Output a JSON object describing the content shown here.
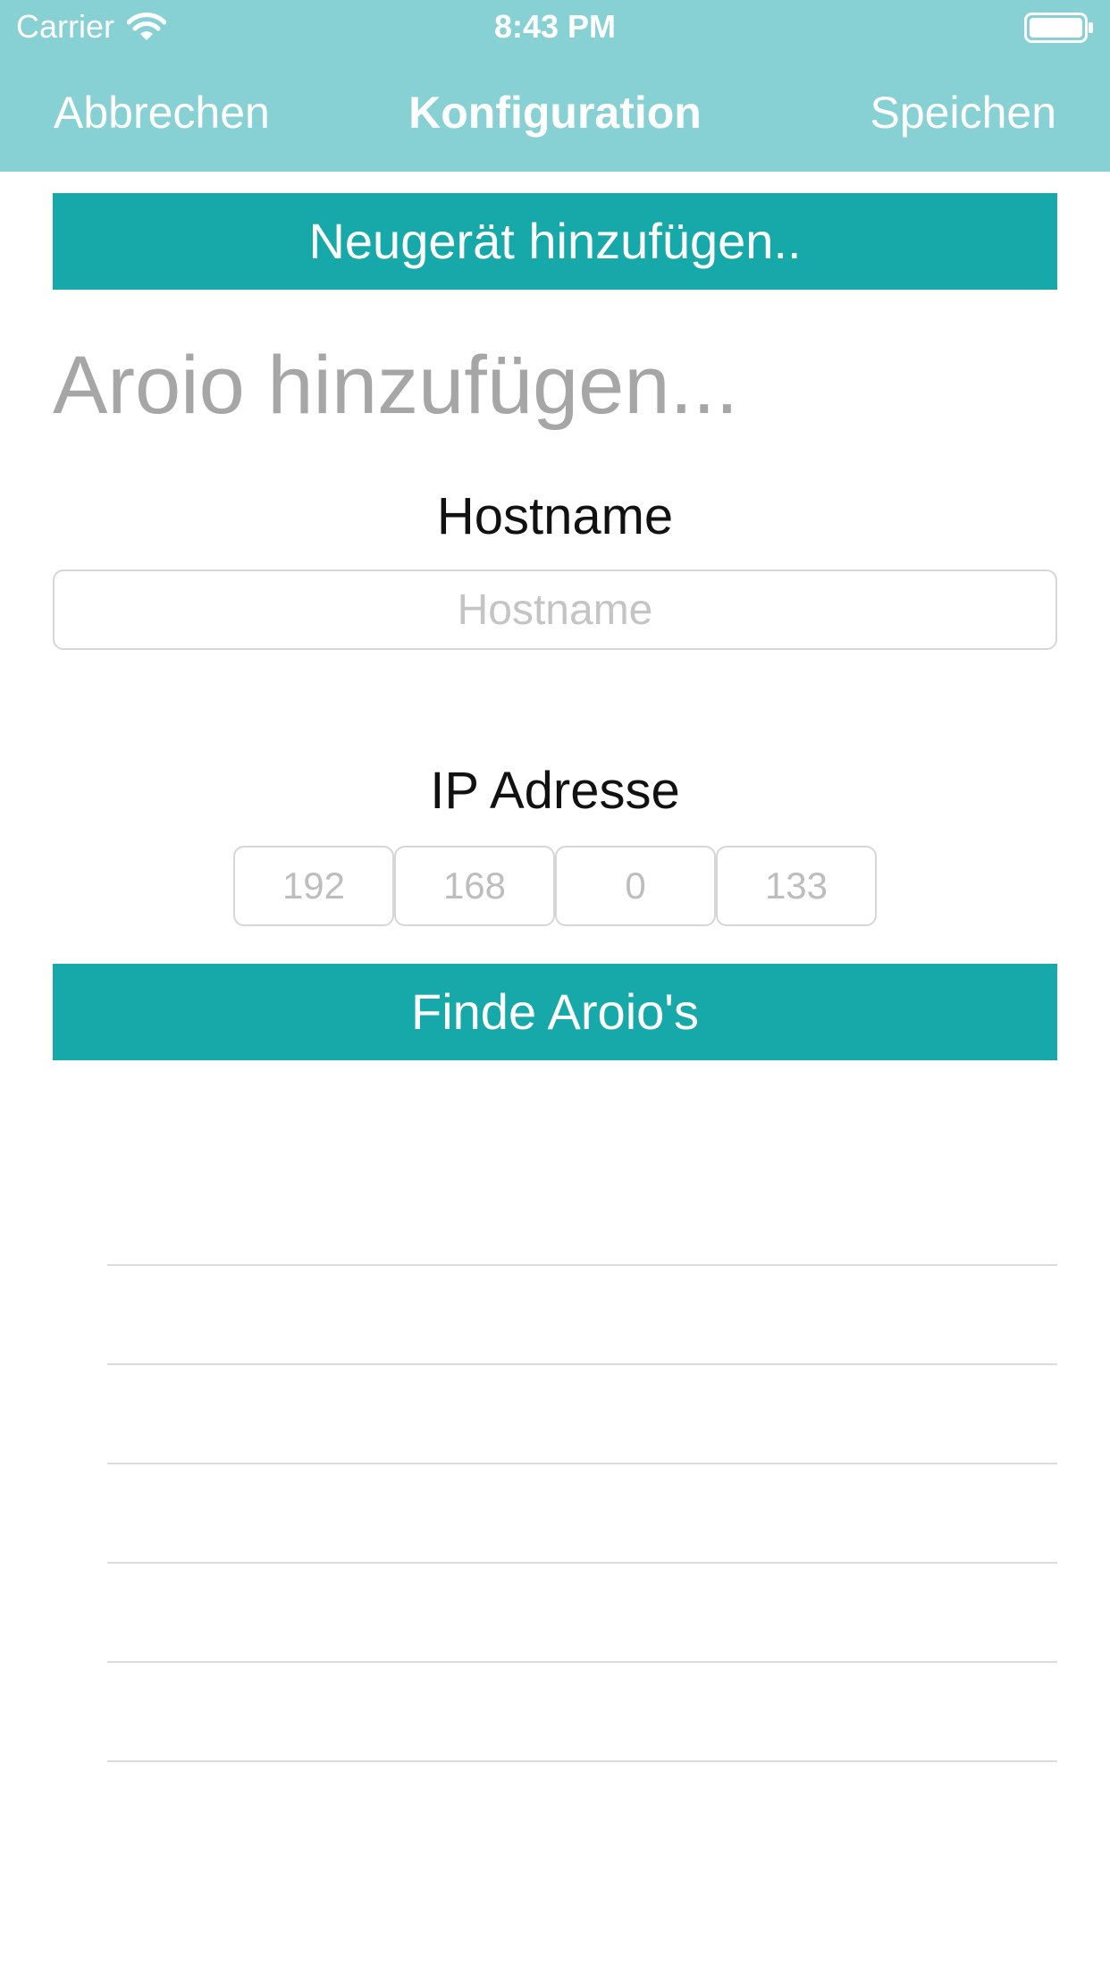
{
  "status_bar": {
    "carrier": "Carrier",
    "time": "8:43 PM",
    "wifi_icon": "wifi-icon",
    "battery_icon": "battery-icon"
  },
  "nav_bar": {
    "cancel_label": "Abbrechen",
    "title": "Konfiguration",
    "save_label": "Speichen"
  },
  "add_new_device_button": "Neugerät hinzufügen..",
  "section_heading": "Aroio hinzufügen...",
  "hostname": {
    "label": "Hostname",
    "placeholder": "Hostname",
    "value": ""
  },
  "ip_address": {
    "label": "IP Adresse",
    "octets": [
      {
        "placeholder": "192",
        "value": ""
      },
      {
        "placeholder": "168",
        "value": ""
      },
      {
        "placeholder": "0",
        "value": ""
      },
      {
        "placeholder": "133",
        "value": ""
      }
    ]
  },
  "find_button": "Finde Aroio's",
  "results": [
    "",
    "",
    "",
    "",
    "",
    ""
  ],
  "colors": {
    "header_bg": "#87d1d4",
    "accent": "#17a9a9",
    "heading_gray": "#a6a6a6",
    "separator": "#dcdcdc"
  }
}
